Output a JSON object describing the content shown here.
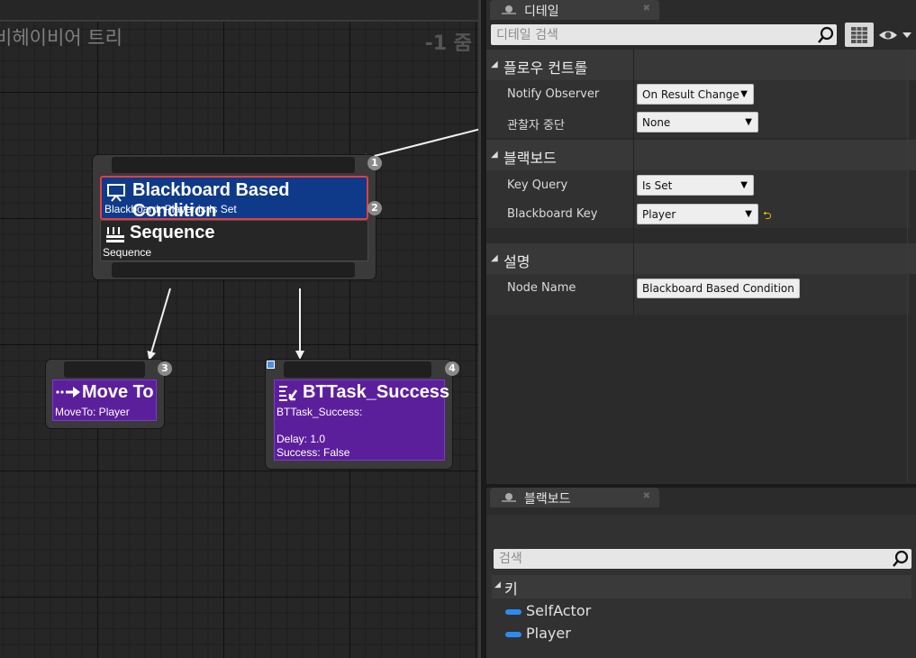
{
  "graph": {
    "title": "비헤이비어 트리",
    "zoom": "-1 줌",
    "nodes": {
      "root_composite": {
        "badge_top": "1",
        "badge_decorator": "2",
        "decorator_title": "Blackboard Based Condition",
        "decorator_subtitle": "Blackboard: Player is Is Set",
        "composite_title": "Sequence",
        "composite_subtitle": "Sequence"
      },
      "move_to": {
        "badge": "3",
        "title": "Move To",
        "subtitle": "MoveTo: Player"
      },
      "bttask_success": {
        "badge": "4",
        "title": "BTTask_Success",
        "line1": "BTTask_Success:",
        "line2": "Delay: 1.0",
        "line3": "Success: False"
      }
    }
  },
  "details": {
    "tab_label": "디테일",
    "search_placeholder": "디테일 검색",
    "sections": {
      "flow_control": {
        "label": "플로우 컨트롤",
        "notify_observer_label": "Notify Observer",
        "notify_observer_value": "On Result Change",
        "observer_aborts_label": "관찰자 중단",
        "observer_aborts_value": "None"
      },
      "blackboard": {
        "label": "블랙보드",
        "key_query_label": "Key Query",
        "key_query_value": "Is Set",
        "blackboard_key_label": "Blackboard Key",
        "blackboard_key_value": "Player"
      },
      "description": {
        "label": "설명",
        "node_name_label": "Node Name",
        "node_name_value": "Blackboard Based Condition"
      }
    }
  },
  "blackboard_panel": {
    "tab_label": "블랙보드",
    "search_placeholder": "검색",
    "keys_section": "키",
    "keys": [
      "SelfActor",
      "Player"
    ]
  },
  "colors": {
    "decorator_blue": "#0f3a8a",
    "task_purple": "#5c1f9c",
    "selection_red": "#e04040",
    "key_blue": "#2a8cf0"
  }
}
